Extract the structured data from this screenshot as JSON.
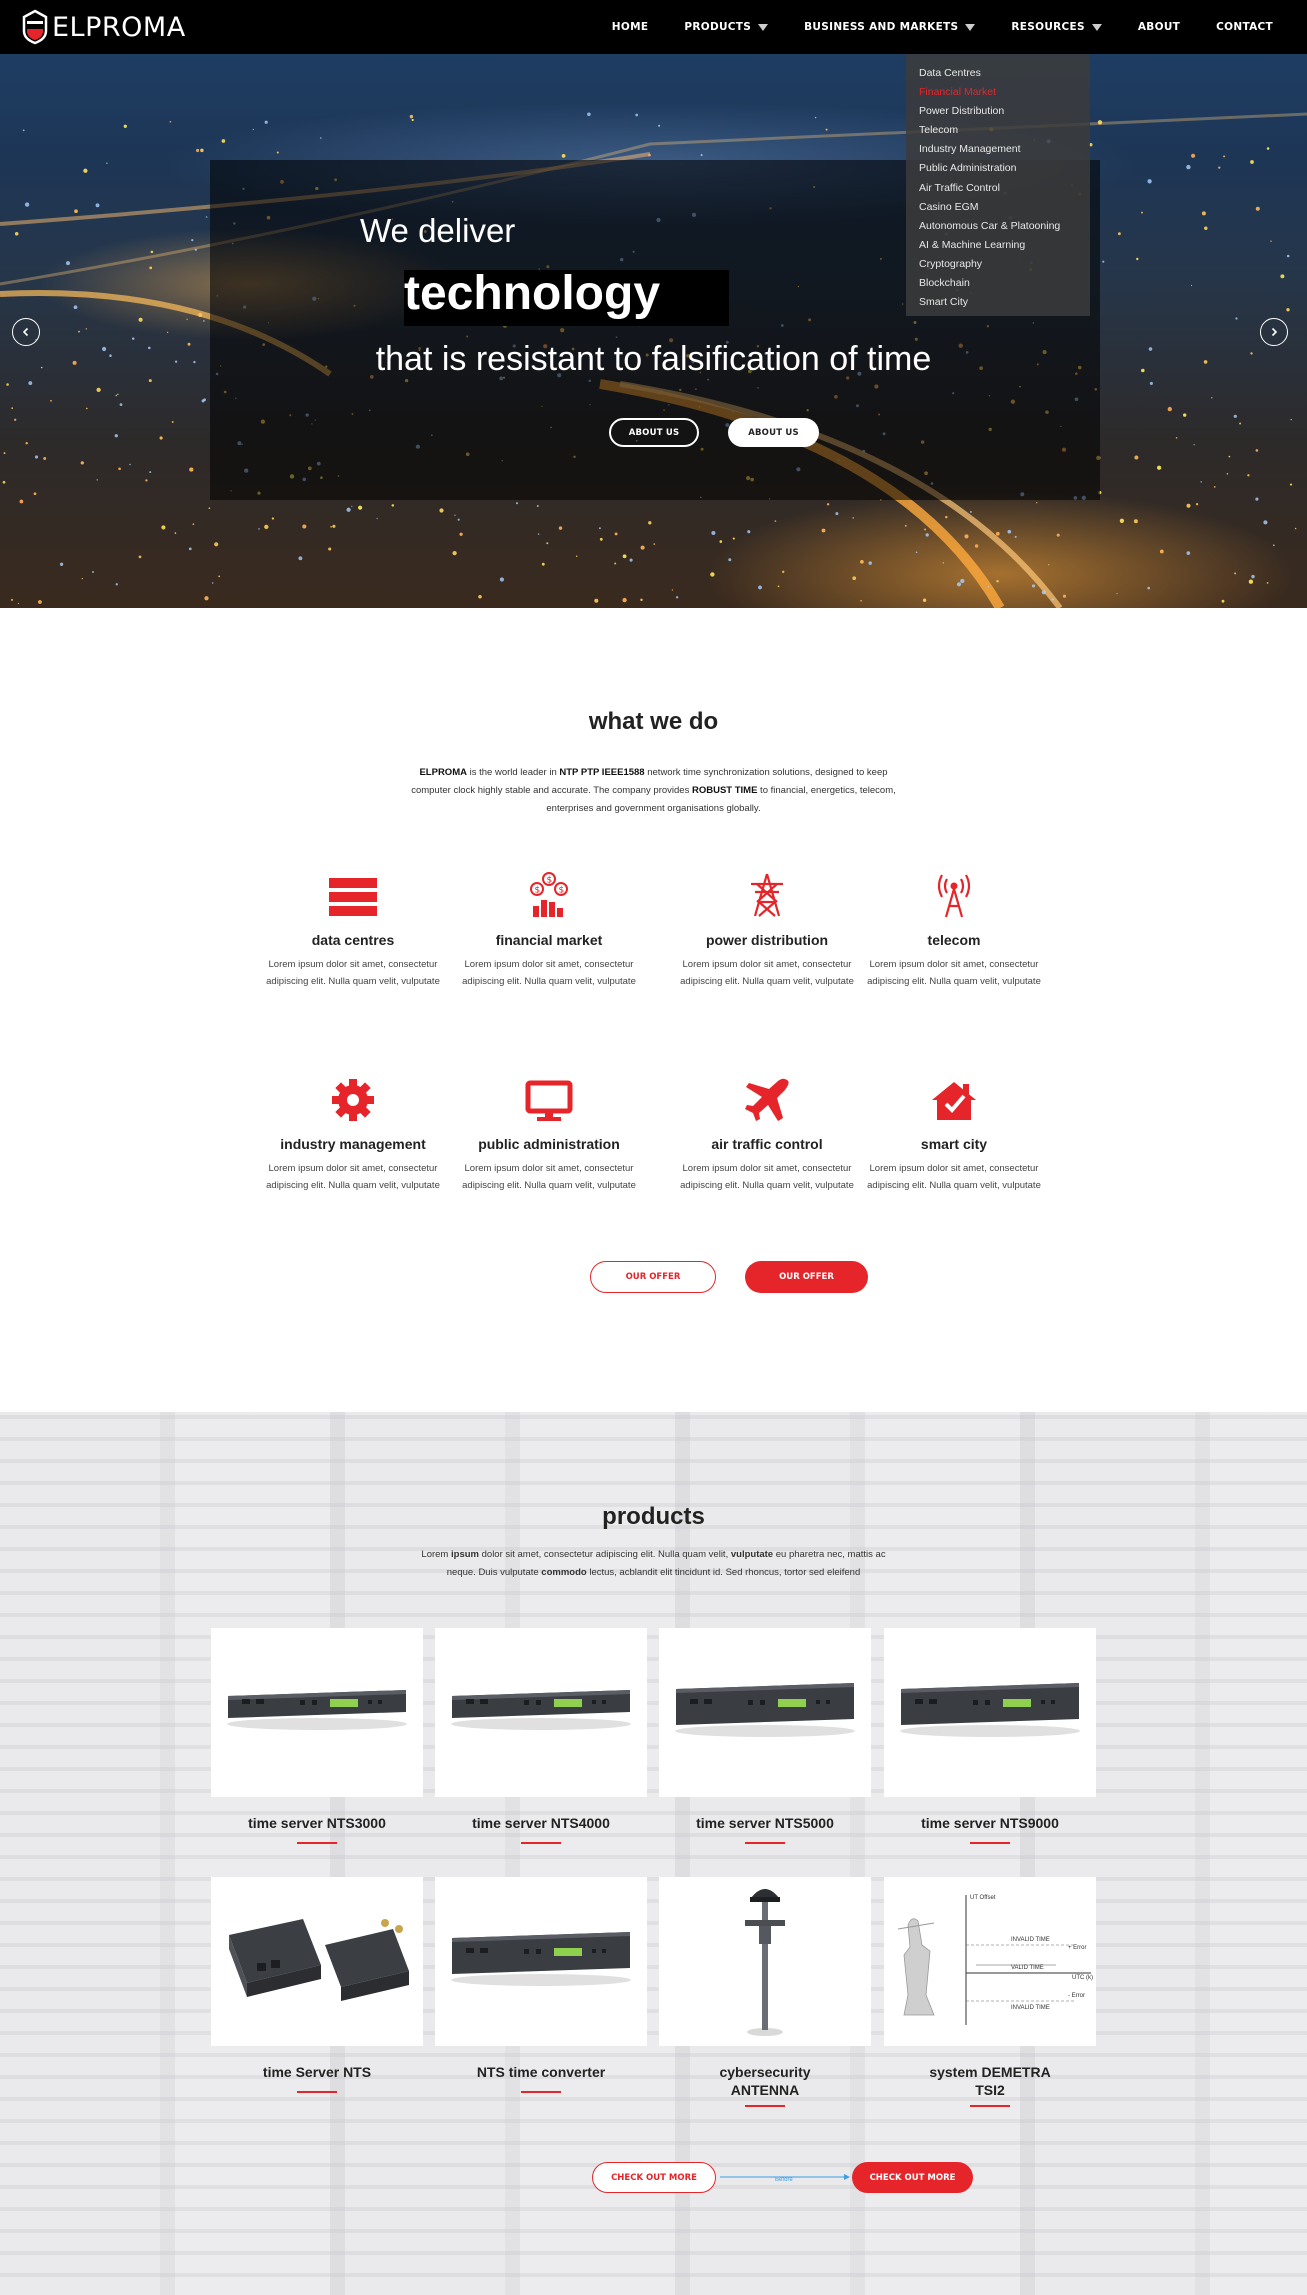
{
  "brand": {
    "name": "ELPROMA",
    "accent": "#e5252a"
  },
  "nav": {
    "items": [
      {
        "label": "HOME",
        "has_caret": false
      },
      {
        "label": "PRODUCTS",
        "has_caret": true
      },
      {
        "label": "BUSINESS AND MARKETS",
        "has_caret": true
      },
      {
        "label": "RESOURCES",
        "has_caret": true
      },
      {
        "label": "ABOUT",
        "has_caret": false
      },
      {
        "label": "CONTACT",
        "has_caret": false
      }
    ]
  },
  "dropdown": {
    "items": [
      "Data Centres",
      "Financial Market",
      "Power Distribution",
      "Telecom",
      "Industry Management",
      "Public Administration",
      "Air Traffic Control",
      "Casino EGM",
      "Autonomous Car & Platooning",
      "AI & Machine Learning",
      "Cryptography",
      "Blockchain",
      "Smart City"
    ],
    "active_index": 1
  },
  "hero": {
    "line1": "We deliver",
    "line2": "technology",
    "line3": "that is resistant to falsification of time",
    "button_outline": "ABOUT US",
    "button_solid": "ABOUT US"
  },
  "what_we_do": {
    "title": "what we do",
    "intro": {
      "b1": "ELPROMA",
      "t1": " is the world leader in ",
      "b2": "NTP PTP IEEE1588",
      "t2": " network time synchronization solutions, designed to keep computer clock highly stable and accurate. The company provides ",
      "b3": "ROBUST TIME",
      "t3": " to financial, energetics, telecom, enterprises and government organisations globally."
    },
    "services": [
      {
        "title": "data centres",
        "icon": "server-stack-icon",
        "desc": "Lorem ipsum dolor sit amet, consectetur adipiscing elit. Nulla quam velit, vulputate"
      },
      {
        "title": "financial market",
        "icon": "dollar-chart-icon",
        "desc": "Lorem ipsum dolor sit amet, consectetur adipiscing elit. Nulla quam velit, vulputate"
      },
      {
        "title": "power distribution",
        "icon": "power-tower-icon",
        "desc": "Lorem ipsum dolor sit amet, consectetur adipiscing elit. Nulla quam velit, vulputate"
      },
      {
        "title": "telecom",
        "icon": "antenna-icon",
        "desc": "Lorem ipsum dolor sit amet, consectetur adipiscing elit. Nulla quam velit, vulputate"
      },
      {
        "title": "industry management",
        "icon": "gear-icon",
        "desc": "Lorem ipsum dolor sit amet, consectetur adipiscing elit. Nulla quam velit, vulputate"
      },
      {
        "title": "public administration",
        "icon": "monitor-icon",
        "desc": "Lorem ipsum dolor sit amet, consectetur adipiscing elit. Nulla quam velit, vulputate"
      },
      {
        "title": "air traffic control",
        "icon": "airplane-icon",
        "desc": "Lorem ipsum dolor sit amet, consectetur adipiscing elit. Nulla quam velit, vulputate"
      },
      {
        "title": "smart city",
        "icon": "smart-home-icon",
        "desc": "Lorem ipsum dolor sit amet, consectetur adipiscing elit. Nulla quam velit, vulputate"
      }
    ],
    "button_outline": "OUR OFFER",
    "button_solid": "OUR OFFER"
  },
  "products": {
    "title": "products",
    "intro": {
      "t1": "Lorem ",
      "b1": "ipsum",
      "t2": " dolor sit amet, consectetur adipiscing elit. Nulla quam velit, ",
      "b2": "vulputate",
      "t3": " eu pharetra nec, mattis ac neque. Duis vulputate ",
      "b3": "commodo",
      "t4": " lectus, acblandit elit tincidunt id. Sed rhoncus, tortor sed eleifend"
    },
    "items": [
      {
        "name": "time server NTS3000",
        "image": "rack-server"
      },
      {
        "name": "time server NTS4000",
        "image": "rack-server"
      },
      {
        "name": "time server NTS5000",
        "image": "rack-server-tall"
      },
      {
        "name": "time server NTS9000",
        "image": "rack-server-tall"
      },
      {
        "name": "time Server NTS",
        "image": "mini-server-pair"
      },
      {
        "name": "NTS time converter",
        "image": "rack-server-tall"
      },
      {
        "name": "cybersecurity ANTENNA",
        "image": "gps-antenna"
      },
      {
        "name": "system DEMETRA TSI2",
        "image": "justice-diagram"
      }
    ],
    "diagram_labels": [
      "UT Offset",
      "INVALID TIME",
      "+ Error",
      "VALID TIME",
      "UTC (k)",
      "- Error",
      "INVALID TIME"
    ],
    "button_outline": "CHECK OUT MORE",
    "button_solid": "CHECK OUT MORE",
    "arrow_label": "Before"
  }
}
